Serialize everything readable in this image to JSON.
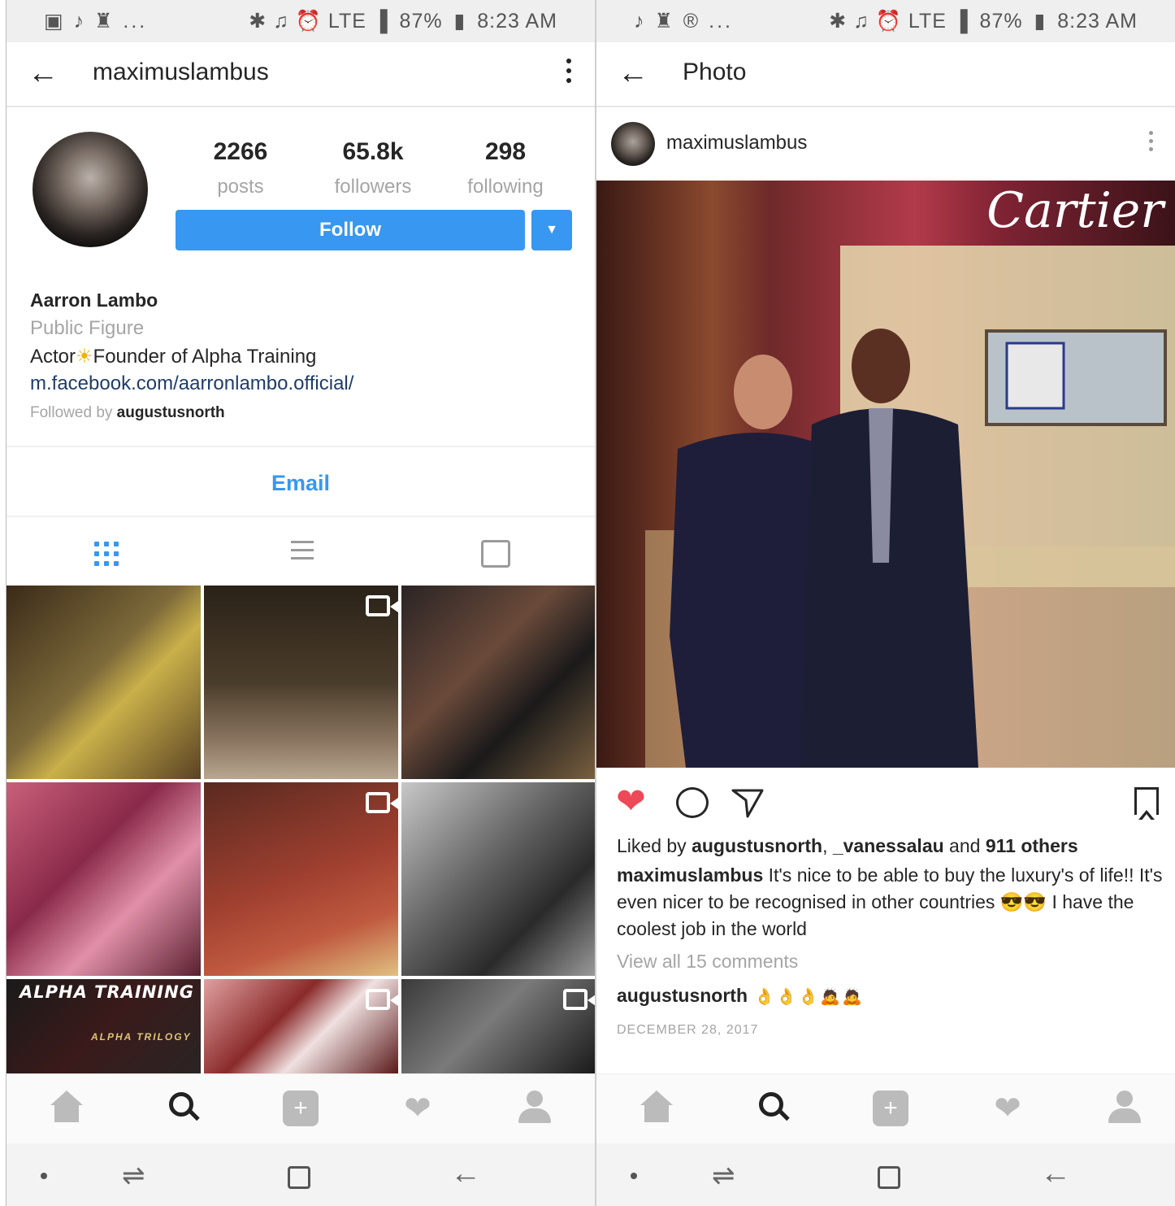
{
  "status_left": {
    "icons_left": "▣ ♪ ♜ ...",
    "right": {
      "battery": "87%",
      "time": "8:23 AM",
      "signal": "✱ ♫ ⏰ LTE ▐"
    }
  },
  "status_right": {
    "icons_left": "♪ ♜ ® ...",
    "right": {
      "battery": "87%",
      "time": "8:23 AM",
      "signal": "✱ ♫ ⏰ LTE ▐"
    }
  },
  "profile": {
    "header_title": "maximuslambus",
    "stats": [
      {
        "value": "2266",
        "label": "posts"
      },
      {
        "value": "65.8k",
        "label": "followers"
      },
      {
        "value": "298",
        "label": "following"
      }
    ],
    "follow_label": "Follow",
    "name": "Aarron Lambo",
    "category": "Public Figure",
    "bio_part1": "Actor",
    "bio_part2": "Founder of Alpha Training",
    "link": "m.facebook.com/aarronlambo.official/",
    "followed_by_prefix": "Followed by ",
    "followed_by_user": "augustusnorth",
    "email_label": "Email",
    "grid_overlay": {
      "title": "ALPHA TRAINING",
      "subtitle": "ALPHA TRILOGY"
    }
  },
  "post": {
    "header_title": "Photo",
    "username": "maximuslambus",
    "brand_text": "Cartier",
    "likes_prefix": "Liked by ",
    "likes_user1": "augustusnorth",
    "likes_sep": ", ",
    "likes_user2": "_vanessalau",
    "likes_and": " and ",
    "likes_others": "911 others",
    "caption_user": "maximuslambus",
    "caption_text": " It's nice to be able to buy the luxury's of life!! It's even nicer to be recognised in other countries 😎😎 I have the coolest job in the world",
    "view_all": "View all 15 comments",
    "comment_user": "augustusnorth",
    "comment_text": " 👌👌👌🙇🙇",
    "date": "DECEMBER 28, 2017"
  },
  "icons": {
    "back": "arrow-left-icon",
    "more": "more-vertical-icon",
    "nav": [
      "home-icon",
      "search-icon",
      "add-icon",
      "heart-icon",
      "profile-icon"
    ],
    "android": [
      "dot-icon",
      "recents-icon",
      "home-square-icon",
      "back-icon"
    ]
  },
  "colors": {
    "accent": "#3897f0",
    "like": "#ed4956",
    "muted": "#a5a5a5",
    "link": "#1f3c6b"
  }
}
